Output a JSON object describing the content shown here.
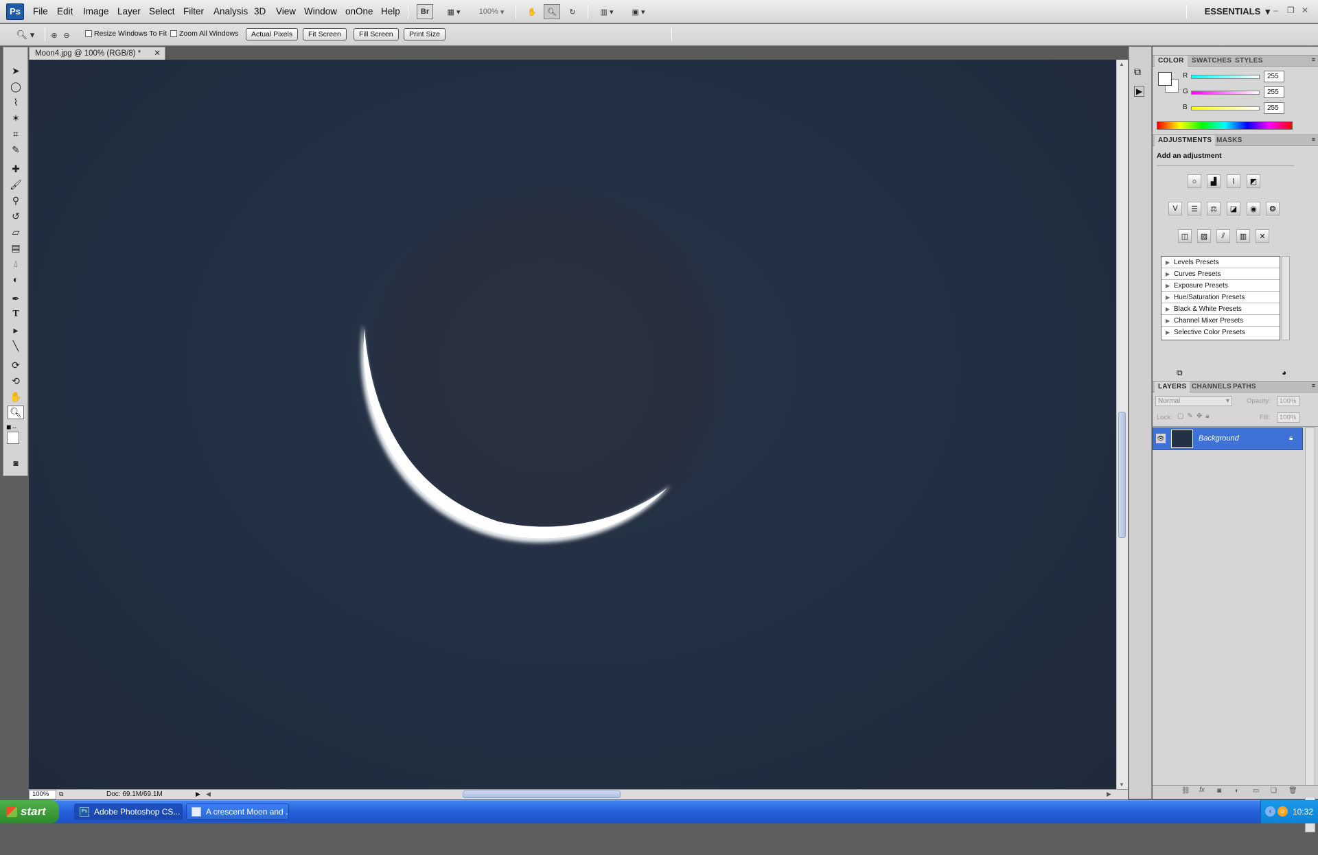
{
  "app": {
    "logo": "Ps"
  },
  "menus": [
    "File",
    "Edit",
    "Image",
    "Layer",
    "Select",
    "Filter",
    "Analysis",
    "3D",
    "View",
    "Window",
    "onOne",
    "Help"
  ],
  "menubar": {
    "bridge_label": "Br",
    "zoom": "100%",
    "workspace": "ESSENTIALS"
  },
  "options": {
    "resize_windows": "Resize Windows To Fit",
    "zoom_all": "Zoom All Windows",
    "buttons": [
      "Actual Pixels",
      "Fit Screen",
      "Fill Screen",
      "Print Size"
    ]
  },
  "document": {
    "tab_title": "Moon4.jpg @ 100% (RGB/8) *",
    "status_zoom": "100%",
    "doc_size": "Doc: 69.1M/69.1M"
  },
  "color_panel": {
    "tabs": [
      "COLOR",
      "SWATCHES",
      "STYLES"
    ],
    "channels": [
      {
        "label": "R",
        "value": "255"
      },
      {
        "label": "G",
        "value": "255"
      },
      {
        "label": "B",
        "value": "255"
      }
    ]
  },
  "adjustments": {
    "tabs": [
      "ADJUSTMENTS",
      "MASKS"
    ],
    "title": "Add an adjustment",
    "presets": [
      "Levels Presets",
      "Curves Presets",
      "Exposure Presets",
      "Hue/Saturation Presets",
      "Black & White Presets",
      "Channel Mixer Presets",
      "Selective Color Presets"
    ]
  },
  "layers": {
    "tabs": [
      "LAYERS",
      "CHANNELS",
      "PATHS"
    ],
    "blend_mode": "Normal",
    "opacity_label": "Opacity:",
    "opacity": "100%",
    "lock_label": "Lock:",
    "fill_label": "Fill:",
    "fill": "100%",
    "items": [
      {
        "name": "Background"
      }
    ]
  },
  "taskbar": {
    "start": "start",
    "tasks": [
      "Adobe Photoshop CS...",
      "A crescent Moon and ..."
    ],
    "clock": "10:32"
  },
  "colors": {
    "selection": "#3f72d6",
    "taskbar": "#235ed8",
    "canvas": "#223045"
  }
}
